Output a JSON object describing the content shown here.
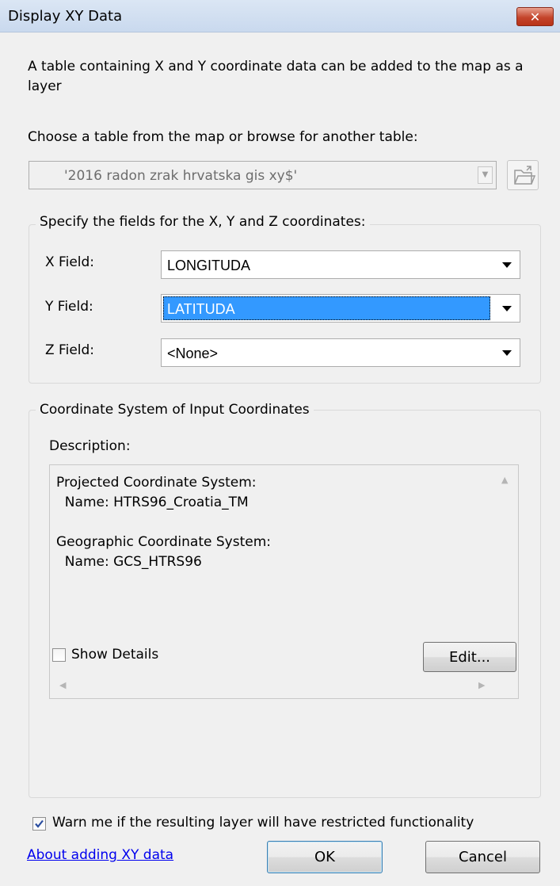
{
  "window": {
    "title": "Display XY Data",
    "close_label": "✕"
  },
  "intro_text": "A table containing X and Y coordinate data can be added to the map as a layer",
  "table_chooser": {
    "label": "Choose a table from the map or browse for another table:",
    "value": "'2016 radon zrak hrvatska gis xy$'",
    "browse_icon": "folder-browse-icon"
  },
  "fields_group": {
    "title": "Specify the fields for the X, Y and Z coordinates:",
    "fields": [
      {
        "label": "X Field:",
        "value": "LONGITUDA"
      },
      {
        "label": "Y Field:",
        "value": "LATITUDA"
      },
      {
        "label": "Z Field:",
        "value": "<None>"
      }
    ]
  },
  "coord_group": {
    "title": "Coordinate System of Input Coordinates",
    "description_label": "Description:",
    "description_lines": [
      "Projected Coordinate System:",
      "  Name: HTRS96_Croatia_TM",
      "",
      "Geographic Coordinate System:",
      "  Name: GCS_HTRS96"
    ],
    "show_details_label": "Show Details",
    "show_details_checked": false,
    "edit_label": "Edit..."
  },
  "warn": {
    "label": "Warn me if the resulting layer will have restricted functionality",
    "checked": true
  },
  "footer": {
    "help_link": "About adding XY data",
    "ok_label": "OK",
    "cancel_label": "Cancel"
  },
  "colors": {
    "selection": "#3399ff",
    "link": "#0000ee",
    "close_button": "#c4452c",
    "dialog_background": "#f0f0f0"
  }
}
